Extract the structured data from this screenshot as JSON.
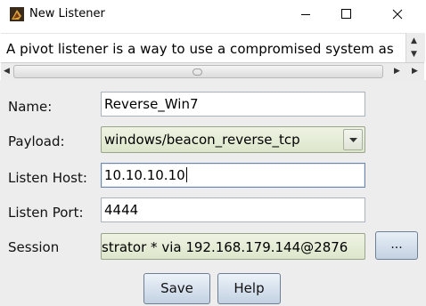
{
  "window": {
    "title": "New Listener",
    "controls": {
      "minimize_icon": "minimize-icon",
      "maximize_icon": "maximize-icon",
      "close_icon": "close-icon"
    }
  },
  "description": {
    "text": "A pivot listener is a way to use a compromised system as"
  },
  "form": {
    "name": {
      "label": "Name:",
      "value": "Reverse_Win7"
    },
    "payload": {
      "label": "Payload:",
      "value": "windows/beacon_reverse_tcp"
    },
    "listen_host": {
      "label": "Listen Host:",
      "value": "10.10.10.10"
    },
    "listen_port": {
      "label": "Listen Port:",
      "value": "4444"
    },
    "session": {
      "label": "Session",
      "value": "strator * via  192.168.179.144@2876",
      "browse_label": "..."
    }
  },
  "buttons": {
    "save": "Save",
    "help": "Help"
  },
  "colors": {
    "combo_bg": "#dde6cb",
    "button_bg": "#c2d1e2",
    "form_bg": "#ededed"
  }
}
